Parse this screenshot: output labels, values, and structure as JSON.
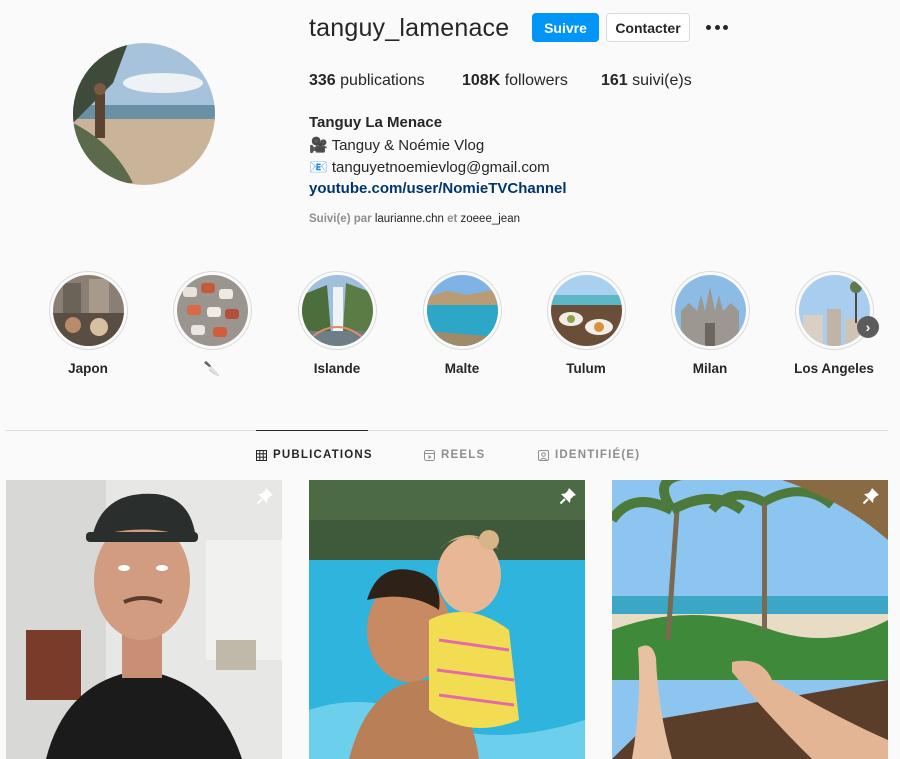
{
  "profile": {
    "username": "tanguy_lamenace",
    "follow_label": "Suivre",
    "contact_label": "Contacter",
    "posts_count": "336",
    "posts_label": " publications",
    "followers_count": "108K",
    "followers_label": " followers",
    "following_count": "161",
    "following_label": " suivi(e)s",
    "full_name": "Tanguy La Menace",
    "bio_line1": "🎥 Tanguy & Noémie Vlog",
    "bio_line2": "📧 tanguyetnoemievlog@gmail.com",
    "link": "youtube.com/user/NomieTVChannel",
    "followed_by_prefix": "Suivi(e) par ",
    "followed_by_user1": "laurianne.chn",
    "followed_by_and": " et ",
    "followed_by_user2": "zoeee_jean"
  },
  "highlights": [
    {
      "label": "Japon"
    },
    {
      "label": "🔪"
    },
    {
      "label": "Islande"
    },
    {
      "label": "Malte"
    },
    {
      "label": "Tulum"
    },
    {
      "label": "Milan"
    },
    {
      "label": "Los Angeles"
    }
  ],
  "tabs": [
    {
      "label": "PUBLICATIONS",
      "icon": "grid-icon",
      "active": true
    },
    {
      "label": "REELS",
      "icon": "reels-icon",
      "active": false
    },
    {
      "label": "IDENTIFIÉ(E)",
      "icon": "tagged-icon",
      "active": false
    }
  ],
  "posts": [
    {
      "pinned": true,
      "subject": "man-with-cap"
    },
    {
      "pinned": true,
      "subject": "pool-with-child"
    },
    {
      "pinned": true,
      "subject": "beach-palms-legs"
    }
  ],
  "colors": {
    "follow_button": "#0095f6",
    "link": "#00376b",
    "secondary_text": "#8e8e8e",
    "background": "#fafafa"
  }
}
